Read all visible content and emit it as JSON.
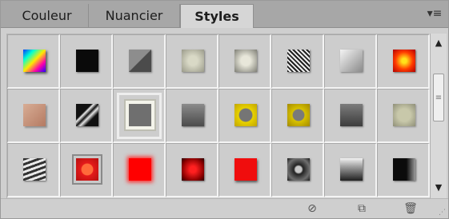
{
  "tabs": [
    {
      "label": "Couleur"
    },
    {
      "label": "Nuancier"
    },
    {
      "label": "Styles",
      "active": true
    }
  ],
  "panel_menu": {
    "icon": "panel-menu-icon",
    "glyph": "▾≡"
  },
  "styles": [
    {
      "name": "style-prism-swatch",
      "bg": "linear-gradient(135deg,#0037ff,#00ffd4,#ffea00,#ff00a8,#2400ff)",
      "shadow": "2px 2px 3px rgba(0,0,0,.6)"
    },
    {
      "name": "style-black-swatch",
      "bg": "#0a0a0a",
      "shadow": "1px 1px 2px rgba(0,0,0,.5)"
    },
    {
      "name": "style-bevel-gray-swatch",
      "bg": "linear-gradient(135deg,#8d8d8d 49%,#4b4b4b 51%)",
      "shadow": "1px 1px 2px rgba(0,0,0,.4)"
    },
    {
      "name": "style-bevel-light-swatch",
      "bg": "radial-gradient(circle,#d9d9c6 30%,#9a9a8a)",
      "shadow": "1px 1px 2px rgba(0,0,0,.4)"
    },
    {
      "name": "style-bevel-tan-swatch",
      "bg": "radial-gradient(circle,#e8e7da 30%,#7f7f76)",
      "shadow": "1px 1px 2px rgba(0,0,0,.4)"
    },
    {
      "name": "style-noise-swatch",
      "bg": "repeating-linear-gradient(45deg,#222 0 2px,#eee 2px 4px)",
      "shadow": "1px 1px 2px rgba(0,0,0,.5)"
    },
    {
      "name": "style-silver-swatch",
      "bg": "linear-gradient(135deg,#f4f4f4,#8a8a8a)",
      "shadow": "1px 1px 2px rgba(0,0,0,.4)"
    },
    {
      "name": "style-fire-swatch",
      "bg": "radial-gradient(circle,#ffe21a 15%,#ff3b00 55%,#b00000)",
      "shadow": "1px 1px 2px rgba(0,0,0,.5)"
    },
    {
      "name": "style-skin-swatch",
      "bg": "linear-gradient(135deg,#d8ad95,#b47a62)",
      "shadow": "2px 2px 2px rgba(0,0,0,.3)"
    },
    {
      "name": "style-marble-swatch",
      "bg": "linear-gradient(135deg,#111 35%,#f0f0f0 40%,#111 50%,#e5e5e5 58%,#111 70%)",
      "shadow": "1px 1px 2px rgba(0,0,0,.5)"
    },
    {
      "name": "style-framed-gray-swatch",
      "bg": "#6f6f6f",
      "shadow": "0 0 0 4px #f3f3ea, 0 0 0 6px #bdbdb2"
    },
    {
      "name": "style-dark-gray-swatch",
      "bg": "linear-gradient(180deg,#8b8b8b,#4b4b4b)",
      "shadow": "1px 1px 2px rgba(0,0,0,.5)"
    },
    {
      "name": "style-gold-button-swatch",
      "bg": "radial-gradient(circle,#757575 40%,#e8d200 45%,#c1a500)",
      "shadow": "1px 1px 2px rgba(0,0,0,.4)"
    },
    {
      "name": "style-gold-frame-swatch",
      "bg": "radial-gradient(circle,#7a7a7a 35%,#d8c200 40%,#a38a00)",
      "shadow": "1px 1px 2px rgba(0,0,0,.4)"
    },
    {
      "name": "style-steel-swatch",
      "bg": "linear-gradient(180deg,#7c7c7c,#3c3c3c)",
      "shadow": "1px 1px 2px rgba(0,0,0,.4)"
    },
    {
      "name": "style-khaki-swatch",
      "bg": "radial-gradient(circle,#c8c8aa 40%,#8f8f78)",
      "shadow": "1px 1px 2px rgba(0,0,0,.3)"
    },
    {
      "name": "style-zigzag-swatch",
      "bg": "repeating-linear-gradient(160deg,#333 0 3px,#e9e9e9 3px 6px)",
      "shadow": "1px 1px 2px rgba(0,0,0,.5)"
    },
    {
      "name": "style-red-framed-swatch",
      "bg": "radial-gradient(circle,#ff6a3a 35%,#e51a1a 40%,#b51010)",
      "shadow": "0 0 0 3px #c9c9c9, 0 0 0 5px #8a8a8a"
    },
    {
      "name": "style-red-glow-swatch",
      "bg": "#ff0000",
      "shadow": "0 0 5px 2px #ff2a2a"
    },
    {
      "name": "style-red-radial-swatch",
      "bg": "radial-gradient(circle,#ff2020 20%,#8b0000 70%,#2b0000)",
      "shadow": "1px 1px 2px rgba(0,0,0,.5)"
    },
    {
      "name": "style-bright-red-swatch",
      "bg": "#f00d0d",
      "shadow": "1px 2px 3px rgba(0,0,0,.6)"
    },
    {
      "name": "style-chrome-knob-swatch",
      "bg": "radial-gradient(circle,#c7c7c7 20%,#222 30%,#6f6f6f 70%,#1b1b1b)",
      "shadow": "1px 1px 2px rgba(0,0,0,.5)"
    },
    {
      "name": "style-glass-dark-swatch",
      "bg": "linear-gradient(180deg,#f2f2f2 0%,#999 40%,#202020 100%)",
      "shadow": "1px 1px 2px rgba(0,0,0,.5)"
    },
    {
      "name": "style-black-chrome-swatch",
      "bg": "linear-gradient(90deg,#0b0b0b 60%,#9a9a9a 100%)",
      "shadow": "1px 1px 2px rgba(0,0,0,.5)"
    }
  ],
  "selected_index": 10,
  "scroll": {
    "up_icon": "scroll-up-icon",
    "down_icon": "scroll-down-icon"
  },
  "footer": {
    "buttons": [
      {
        "name": "clear-style-button",
        "icon": "no-symbol-icon",
        "glyph": "⃠"
      },
      {
        "name": "new-style-button",
        "icon": "new-page-icon",
        "glyph": "⧉"
      },
      {
        "name": "delete-style-button",
        "icon": "trash-icon",
        "glyph": "🗑"
      }
    ]
  }
}
